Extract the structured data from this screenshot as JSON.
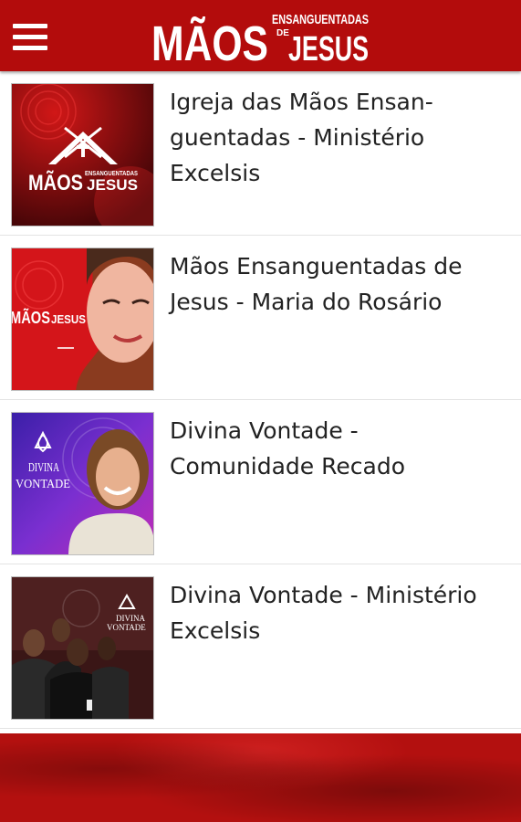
{
  "header": {
    "logo_main": "MÃOS",
    "logo_top": "ENSANGUENTADAS",
    "logo_de": "DE",
    "logo_bottom": "JESUS",
    "background_color": "#b30c0c"
  },
  "items": [
    {
      "title": "Igreja das Mãos Ensanguentadas - Ministério Excelsis",
      "title_display": "Igreja das Mãos Ensan- guentadas - Ministério Excelsis",
      "cover_logo_main": "MÃOS",
      "cover_logo_top": "ENSANGUENTADAS",
      "cover_logo_bottom": "JESUS"
    },
    {
      "title": "Mãos Ensanguentadas de Jesus - Maria do Rosário",
      "cover_logo_main": "MÃOS",
      "cover_logo_bottom": "JESUS"
    },
    {
      "title": "Divina Vontade - Comunidade Recado",
      "cover_logo_top": "DIVINA",
      "cover_logo_bottom": "VONTADE"
    },
    {
      "title": "Divina Vontade - Ministério Excelsis",
      "cover_logo_top": "DIVINA",
      "cover_logo_bottom": "VONTADE"
    }
  ]
}
